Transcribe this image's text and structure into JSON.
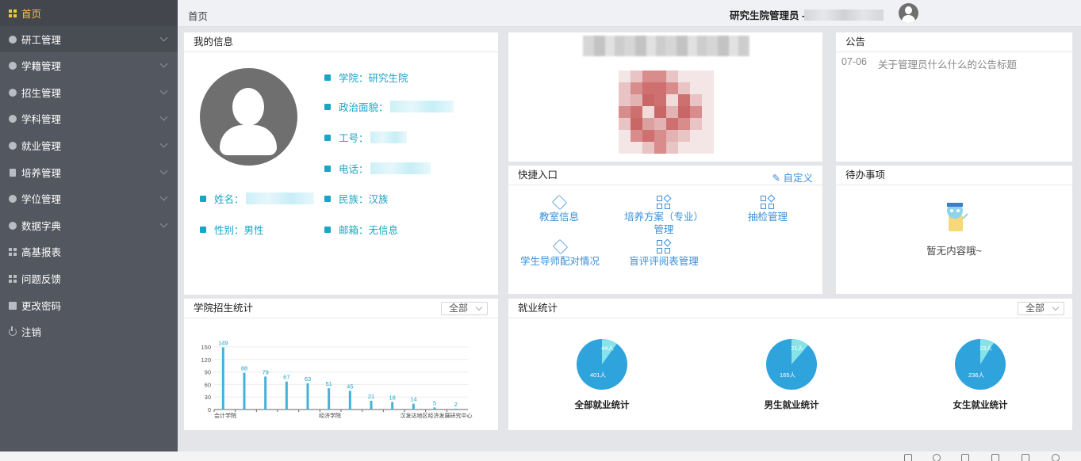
{
  "sidebar": {
    "items": [
      {
        "label": "首页",
        "icon": "grid-icon"
      },
      {
        "label": "研工管理",
        "icon": "dot-icon"
      },
      {
        "label": "学籍管理",
        "icon": "dot-icon"
      },
      {
        "label": "招生管理",
        "icon": "dot-icon"
      },
      {
        "label": "学科管理",
        "icon": "dot-icon"
      },
      {
        "label": "就业管理",
        "icon": "dot-icon"
      },
      {
        "label": "培养管理",
        "icon": "doc-icon"
      },
      {
        "label": "学位管理",
        "icon": "dot-icon"
      },
      {
        "label": "数据字典",
        "icon": "dot-icon"
      },
      {
        "label": "高基报表",
        "icon": "grid-icon"
      },
      {
        "label": "问题反馈",
        "icon": "grid-icon"
      },
      {
        "label": "更改密码",
        "icon": "square-icon"
      },
      {
        "label": "注销",
        "icon": "power-icon"
      }
    ]
  },
  "header": {
    "breadcrumb": "首页",
    "user_label": "研究生院管理员 -"
  },
  "my_info": {
    "title": "我的信息",
    "college": "学院：研究生院",
    "political": "政治面貌：",
    "job_no": "工号：",
    "phone": "电话：",
    "name": "姓名：",
    "ethnicity": "民族：汉族",
    "gender": "性别：男性",
    "mailbox": "邮箱：无信息"
  },
  "notice": {
    "title": "公告",
    "items": [
      {
        "date": "07-06",
        "text": "关于管理员什么什么的公告标题"
      }
    ]
  },
  "quick": {
    "title": "快捷入口",
    "edit_label": "自定义",
    "items": [
      "教室信息",
      "培养方案（专业）管理",
      "抽检管理",
      "学生导师配对情况",
      "盲评评阅表管理"
    ]
  },
  "todo": {
    "title": "待办事项",
    "empty_text": "暂无内容哦~"
  },
  "enroll": {
    "title": "学院招生统计",
    "select_value": "全部"
  },
  "employment": {
    "title": "就业统计",
    "select_value": "全部"
  },
  "colors": {
    "sidebar_bg": "#53575f",
    "active_text": "#f5c242",
    "accent_teal": "#1aa5c4",
    "accent_blue": "#3a8fd9",
    "pie_main": "#2fa3dc",
    "pie_light": "#86e4e8"
  },
  "chart_data": [
    {
      "type": "bar",
      "categories": [
        "会计学院",
        "",
        "",
        "",
        "",
        "经济学院",
        "",
        "",
        "",
        "",
        "",
        "",
        "汉发达地区经济发展研究中心"
      ],
      "values": [
        149,
        88,
        79,
        67,
        63,
        51,
        45,
        21,
        18,
        14,
        5,
        2
      ],
      "value_labels": [
        "149",
        "88",
        "79",
        "67",
        "63",
        "51",
        "45",
        "21",
        "18",
        "14",
        "5",
        "2"
      ],
      "yticks": [
        "150",
        "120",
        "90",
        "60",
        "30",
        "0"
      ],
      "ylim": [
        0,
        150
      ],
      "grid": true
    },
    {
      "type": "pie",
      "title": "全部就业统计",
      "slices": [
        {
          "label": "401人",
          "value": 401
        },
        {
          "label": "44人",
          "value": 44
        }
      ]
    },
    {
      "type": "pie",
      "title": "男生就业统计",
      "slices": [
        {
          "label": "165人",
          "value": 165
        },
        {
          "label": "21人",
          "value": 21
        }
      ]
    },
    {
      "type": "pie",
      "title": "女生就业统计",
      "slices": [
        {
          "label": "236人",
          "value": 236
        },
        {
          "label": "23人",
          "value": 23
        }
      ]
    }
  ]
}
